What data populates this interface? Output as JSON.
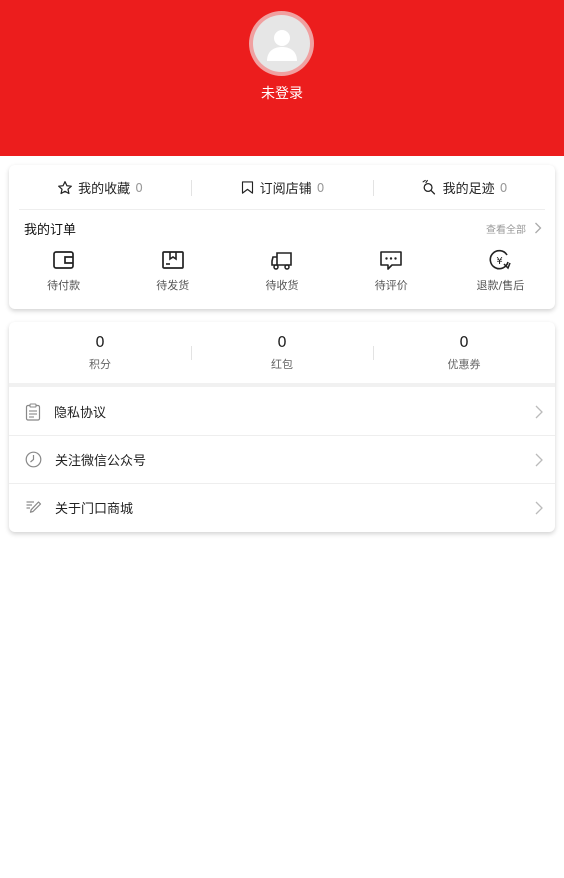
{
  "header": {
    "login_text": "未登录",
    "background_color": "#ec1d1d"
  },
  "quick_links": [
    {
      "label": "我的收藏",
      "count": "0",
      "icon": "star-icon"
    },
    {
      "label": "订阅店铺",
      "count": "0",
      "icon": "bookmark-icon"
    },
    {
      "label": "我的足迹",
      "count": "0",
      "icon": "footprint-icon"
    }
  ],
  "orders": {
    "title": "我的订单",
    "view_all": "查看全部",
    "items": [
      {
        "label": "待付款",
        "icon": "wallet-icon"
      },
      {
        "label": "待发货",
        "icon": "box-icon"
      },
      {
        "label": "待收货",
        "icon": "truck-icon"
      },
      {
        "label": "待评价",
        "icon": "comment-icon"
      },
      {
        "label": "退款/售后",
        "icon": "refund-icon"
      }
    ]
  },
  "points": [
    {
      "value": "0",
      "label": "积分"
    },
    {
      "value": "0",
      "label": "红包"
    },
    {
      "value": "0",
      "label": "优惠券"
    }
  ],
  "menu": [
    {
      "label": "隐私协议",
      "icon": "clipboard-icon"
    },
    {
      "label": "关注微信公众号",
      "icon": "clock-icon"
    },
    {
      "label": "关于门口商城",
      "icon": "pen-icon"
    }
  ]
}
